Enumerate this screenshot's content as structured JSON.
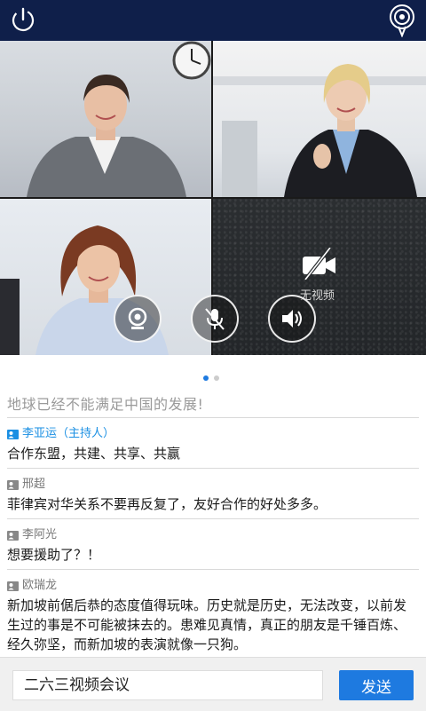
{
  "topbar": {
    "power_icon": "power-icon",
    "speaker_icon": "speaker-icon"
  },
  "video": {
    "tiles": [
      {
        "name": "participant-1"
      },
      {
        "name": "participant-2"
      },
      {
        "name": "participant-3"
      },
      {
        "name": "participant-4",
        "no_video_label": "无视频"
      }
    ],
    "controls": [
      "camera-icon",
      "mic-muted-icon",
      "volume-icon"
    ]
  },
  "pager": {
    "pages": 2,
    "active": 1
  },
  "chat": {
    "system_message": "地球已经不能满足中国的发展!",
    "messages": [
      {
        "sender": "李亚运（主持人）",
        "host": true,
        "text": "合作东盟，共建、共享、共赢"
      },
      {
        "sender": "邢超",
        "host": false,
        "text": "菲律宾对华关系不要再反复了，友好合作的好处多多。"
      },
      {
        "sender": "李阿光",
        "host": false,
        "text": "想要援助了？！"
      },
      {
        "sender": "欧瑞龙",
        "host": false,
        "text": "新加坡前倨后恭的态度值得玩味。历史就是历史，无法改变，以前发生过的事是不可能被抹去的。患难见真情，真正的朋友是千锤百炼、经久弥坚，而新加坡的表演就像一只狗。"
      }
    ]
  },
  "input": {
    "value": "二六三视频会议"
  },
  "send_button": {
    "label": "发送"
  },
  "colors": {
    "topbar": "#0f1f4a",
    "accent": "#1e7ae0",
    "host_name": "#1a8fe3"
  }
}
